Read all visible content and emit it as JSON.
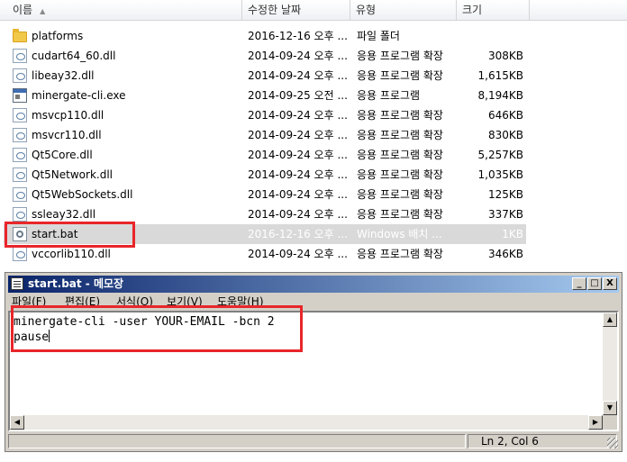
{
  "explorer": {
    "columns": {
      "name": "이름",
      "date": "수정한 날짜",
      "type": "유형",
      "size": "크기"
    },
    "files": [
      {
        "name": "platforms",
        "date": "2016-12-16 오후 ...",
        "type": "파일 폴더",
        "size": "",
        "icon": "folder-icon"
      },
      {
        "name": "cudart64_60.dll",
        "date": "2014-09-24 오후 ...",
        "type": "응용 프로그램 확장",
        "size": "308KB",
        "icon": "dll-file-icon"
      },
      {
        "name": "libeay32.dll",
        "date": "2014-09-24 오후 ...",
        "type": "응용 프로그램 확장",
        "size": "1,615KB",
        "icon": "dll-file-icon"
      },
      {
        "name": "minergate-cli.exe",
        "date": "2014-09-25 오전 ...",
        "type": "응용 프로그램",
        "size": "8,194KB",
        "icon": "exe-file-icon"
      },
      {
        "name": "msvcp110.dll",
        "date": "2014-09-24 오후 ...",
        "type": "응용 프로그램 확장",
        "size": "646KB",
        "icon": "dll-file-icon"
      },
      {
        "name": "msvcr110.dll",
        "date": "2014-09-24 오후 ...",
        "type": "응용 프로그램 확장",
        "size": "830KB",
        "icon": "dll-file-icon"
      },
      {
        "name": "Qt5Core.dll",
        "date": "2014-09-24 오후 ...",
        "type": "응용 프로그램 확장",
        "size": "5,257KB",
        "icon": "dll-file-icon"
      },
      {
        "name": "Qt5Network.dll",
        "date": "2014-09-24 오후 ...",
        "type": "응용 프로그램 확장",
        "size": "1,035KB",
        "icon": "dll-file-icon"
      },
      {
        "name": "Qt5WebSockets.dll",
        "date": "2014-09-24 오후 ...",
        "type": "응용 프로그램 확장",
        "size": "125KB",
        "icon": "dll-file-icon"
      },
      {
        "name": "ssleay32.dll",
        "date": "2014-09-24 오후 ...",
        "type": "응용 프로그램 확장",
        "size": "337KB",
        "icon": "dll-file-icon"
      },
      {
        "name": "start.bat",
        "date": "2016-12-16 오후 ...",
        "type": "Windows 배치 ...",
        "size": "1KB",
        "icon": "batch-file-icon",
        "selected": true
      },
      {
        "name": "vccorlib110.dll",
        "date": "2014-09-24 오후 ...",
        "type": "응용 프로그램 확장",
        "size": "346KB",
        "icon": "dll-file-icon"
      }
    ]
  },
  "notepad": {
    "title": "start.bat - 메모장",
    "menu": [
      "파일(F)",
      "편집(E)",
      "서식(O)",
      "보기(V)",
      "도움말(H)"
    ],
    "content_line1": "minergate-cli -user YOUR-EMAIL -bcn 2",
    "content_line2": "pause",
    "status": "Ln 2, Col 6",
    "window_buttons": {
      "minimize": "_",
      "maximize": "□",
      "close": "X"
    }
  },
  "colors": {
    "highlight_box": "#e8262a",
    "selected_row": "#d9d9d9",
    "titlebar_start": "#0a246a",
    "titlebar_end": "#a6caf0"
  }
}
